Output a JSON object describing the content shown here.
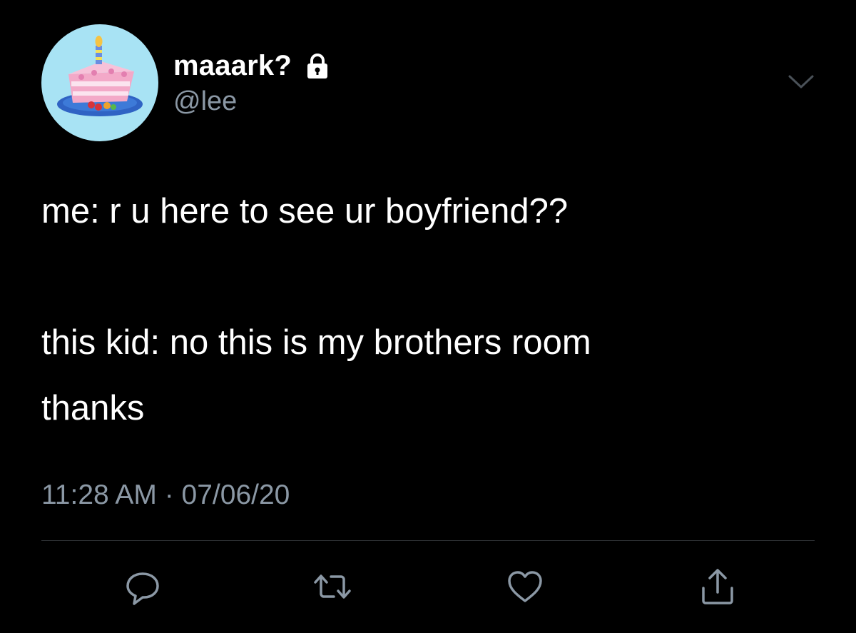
{
  "author": {
    "display_name": "maaark?",
    "handle": "@lee",
    "avatar_icon": "birthday-cake-avatar",
    "protected_icon": "lock-icon"
  },
  "tweet": {
    "lines": [
      "me: r u here to see ur boyfriend??",
      "",
      "this kid: no this is my brothers room",
      "thanks"
    ],
    "timestamp": "11:28 AM · 07/06/20"
  },
  "actions": {
    "reply_icon": "reply-icon",
    "retweet_icon": "retweet-icon",
    "like_icon": "heart-icon",
    "share_icon": "share-icon"
  },
  "colors": {
    "background": "#000000",
    "text": "#ffffff",
    "secondary_text": "#8b98a5",
    "icon": "#8b98a5",
    "divider": "#2f3336",
    "avatar_bg": "#a8e3f4"
  }
}
